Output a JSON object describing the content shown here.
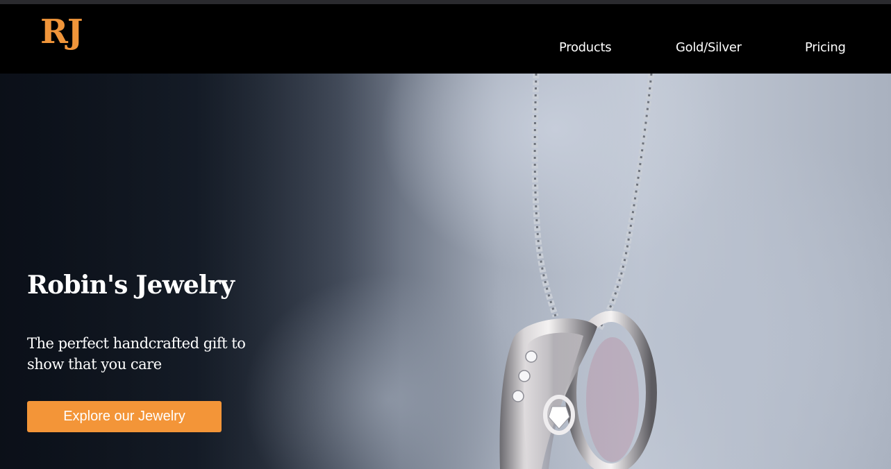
{
  "brand": {
    "logo_text": "RJ",
    "accent_color": "#f0953a"
  },
  "nav": {
    "links": [
      {
        "label": "Products"
      },
      {
        "label": "Gold/Silver"
      },
      {
        "label": "Pricing"
      }
    ]
  },
  "hero": {
    "title": "Robin's Jewelry",
    "subtitle": "The perfect handcrafted gift to show that you care",
    "cta_label": "Explore our Jewelry",
    "cta_color": "#f39538",
    "image_subject": "silver-rings-pendant-on-chain"
  }
}
